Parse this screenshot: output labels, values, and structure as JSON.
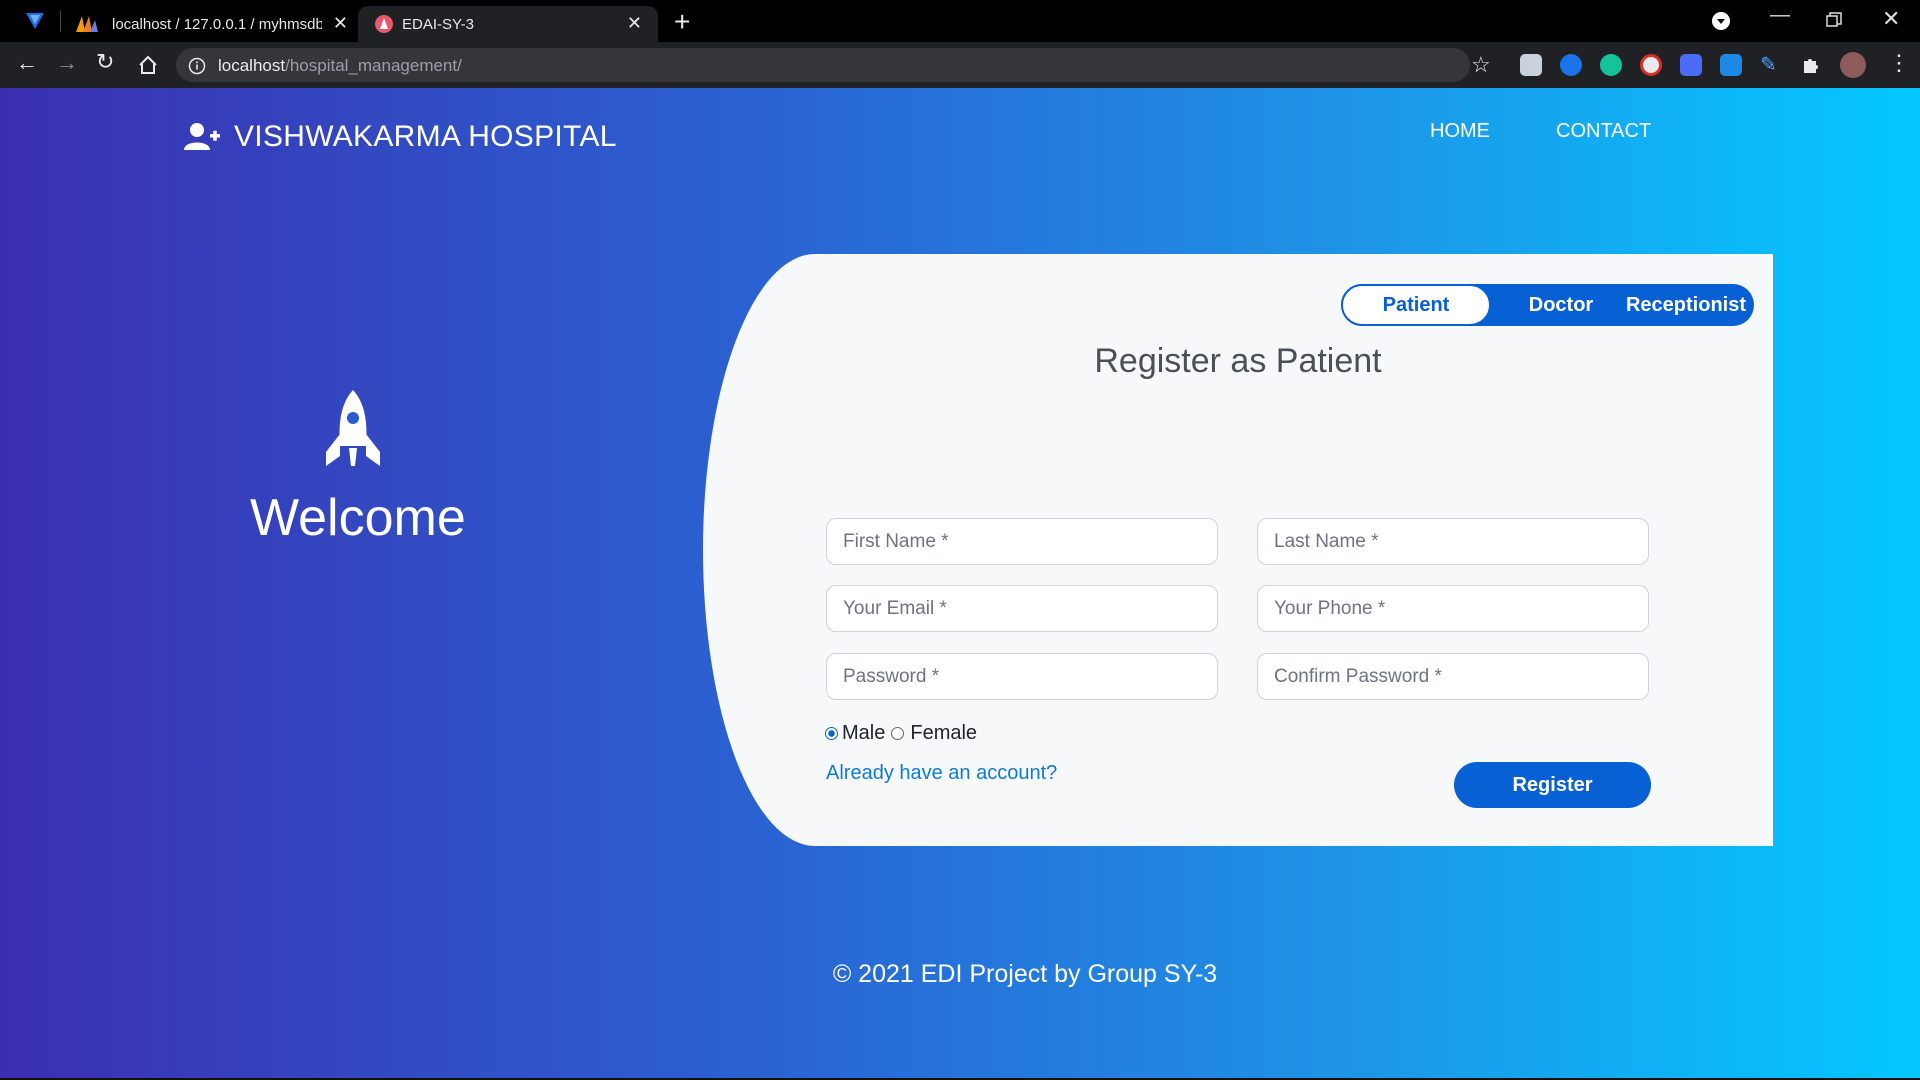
{
  "browser": {
    "tabs": [
      {
        "title": "localhost / 127.0.0.1 / myhmsdb |",
        "icon": "phpmyadmin-icon"
      },
      {
        "title": "EDAI-SY-3",
        "icon": "site-favicon"
      }
    ],
    "url_host": "localhost",
    "url_path": "/hospital_management/"
  },
  "site": {
    "brand": "VISHWAKARMA HOSPITAL",
    "nav": [
      "HOME",
      "CONTACT"
    ],
    "welcome": "Welcome"
  },
  "form": {
    "roles": [
      "Patient",
      "Doctor",
      "Receptionist"
    ],
    "selected_role": "Patient",
    "title": "Register as Patient",
    "placeholders": {
      "first_name": "First Name *",
      "last_name": "Last Name *",
      "email": "Your Email *",
      "phone": "Your Phone *",
      "password": "Password *",
      "confirm_password": "Confirm Password *"
    },
    "genders": [
      "Male",
      "Female"
    ],
    "selected_gender": "Male",
    "login_link": "Already have an account?",
    "submit": "Register"
  },
  "footer": "© 2021 EDI Project by Group SY-3",
  "colors": {
    "gradient_start": "#3b2fb0",
    "gradient_end": "#04c8ff",
    "accent": "#0760d4",
    "card_bg": "#f7f8fa"
  }
}
